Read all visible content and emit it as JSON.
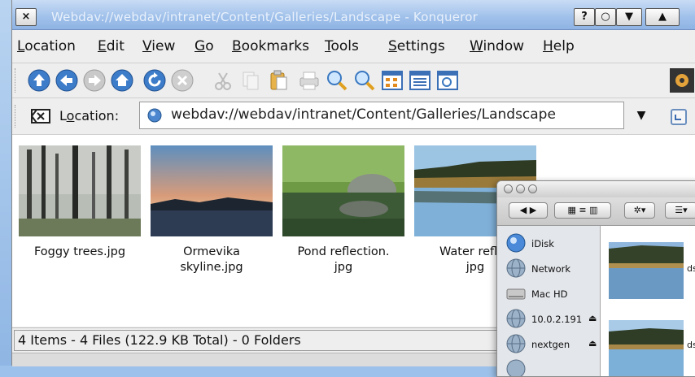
{
  "window": {
    "title": "Webdav://webdav/intranet/Content/Galleries/Landscape - Konqueror",
    "close_glyph": "×",
    "help_glyph": "?",
    "circle_glyph": "○",
    "menu_glyph": "▼",
    "up_glyph": "▲"
  },
  "menu": [
    {
      "pre": "",
      "ul": "L",
      "post": "ocation"
    },
    {
      "pre": "",
      "ul": "E",
      "post": "dit"
    },
    {
      "pre": "",
      "ul": "V",
      "post": "iew"
    },
    {
      "pre": "",
      "ul": "G",
      "post": "o"
    },
    {
      "pre": "",
      "ul": "B",
      "post": "ookmarks"
    },
    {
      "pre": "",
      "ul": "T",
      "post": "ools"
    },
    {
      "pre": "",
      "ul": "S",
      "post": "ettings"
    },
    {
      "pre": "",
      "ul": "W",
      "post": "indow"
    },
    {
      "pre": "",
      "ul": "H",
      "post": "elp"
    }
  ],
  "toolbar_icons": [
    "up-arrow-icon",
    "back-icon",
    "forward-icon",
    "home-icon",
    "reload-icon",
    "stop-icon",
    "cut-icon",
    "copy-icon",
    "paste-icon",
    "print-icon",
    "zoom-in-icon",
    "zoom-out-icon",
    "icon-view-icon",
    "list-view-icon",
    "preview-icon",
    "throbber-gear-icon"
  ],
  "location": {
    "label_pre": "L",
    "label_ul": "o",
    "label_post": "cation:",
    "url": "webdav://webdav/intranet/Content/Galleries/Landscape"
  },
  "files": [
    {
      "line1": "Foggy trees.jpg",
      "line2": ""
    },
    {
      "line1": "Ormevika",
      "line2": "skyline.jpg"
    },
    {
      "line1": "Pond reflection.",
      "line2": "jpg"
    },
    {
      "line1": "Water reflec",
      "line2": "jpg"
    }
  ],
  "status": "4 Items - 4 Files (122.9 KB Total) - 0 Folders",
  "finder": {
    "sidebar": [
      {
        "label": "iDisk",
        "eject": ""
      },
      {
        "label": "Network",
        "eject": ""
      },
      {
        "label": "Mac HD",
        "eject": ""
      },
      {
        "label": "10.0.2.191",
        "eject": "⏏"
      },
      {
        "label": "nextgen",
        "eject": "⏏"
      }
    ],
    "captions": [
      "ds",
      "ds"
    ]
  }
}
